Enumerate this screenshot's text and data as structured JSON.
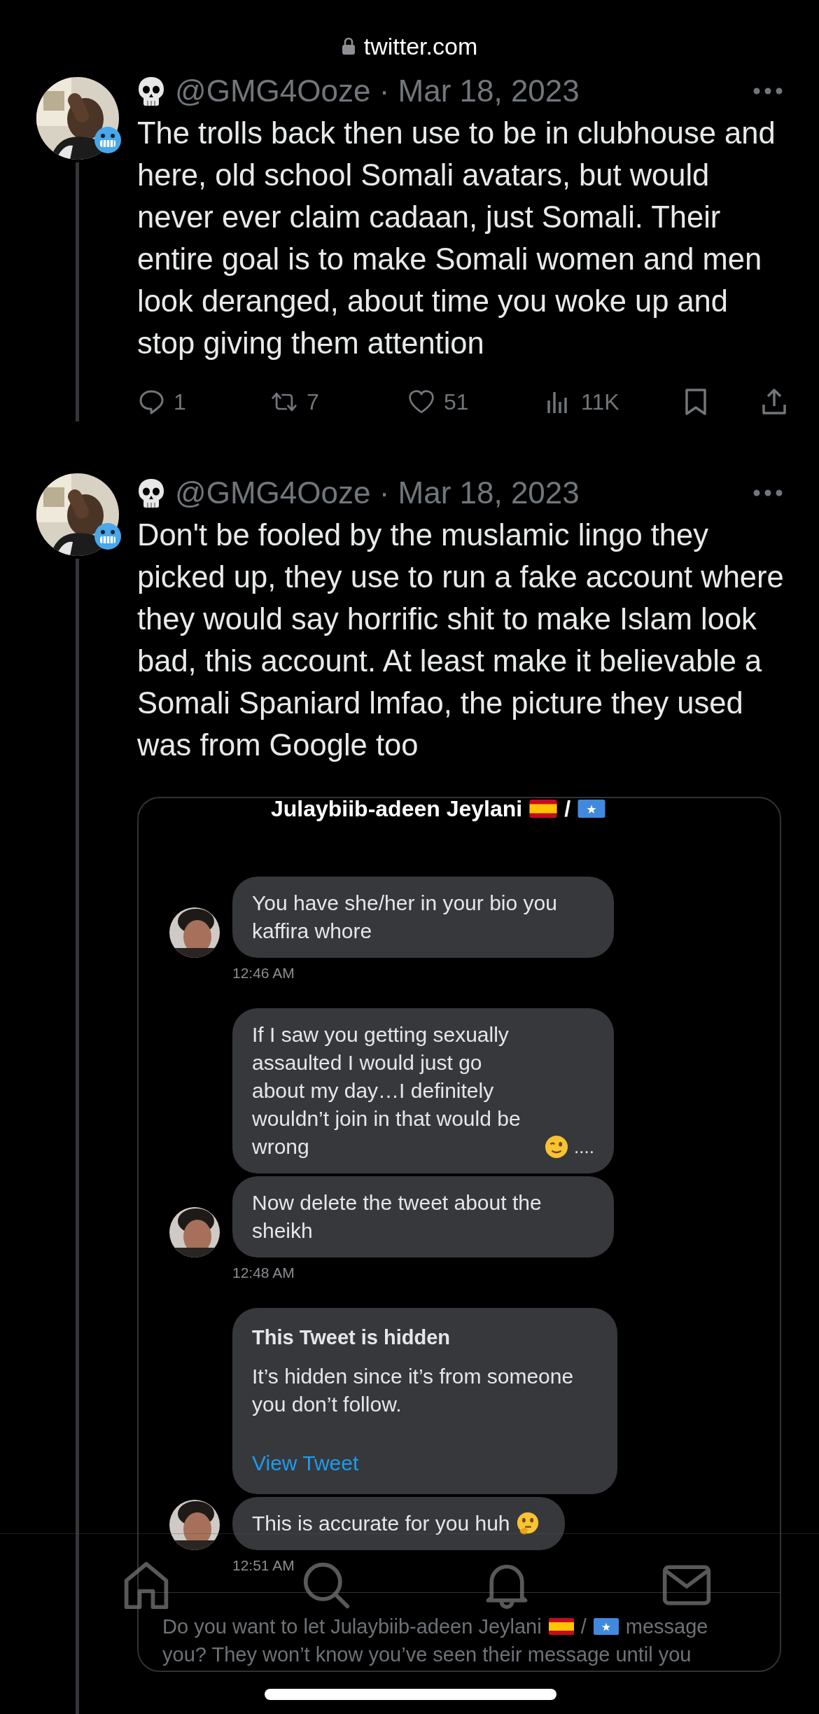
{
  "address_bar": {
    "domain": "twitter.com",
    "secure": true
  },
  "tweets": [
    {
      "avatar": {
        "kind": "picture",
        "badge": true
      },
      "handle": "@GMG4Ooze",
      "separator": "·",
      "date": "Mar 18, 2023",
      "text": "The trolls back then use to be in clubhouse and here, old school Somali avatars, but would never ever claim cadaan, just Somali. Their entire goal is to make Somali women and men look deranged, about time you woke up and stop giving them attention",
      "stats": {
        "replies": "1",
        "retweets": "7",
        "likes": "51",
        "views": "11K"
      }
    },
    {
      "avatar": {
        "kind": "picture",
        "badge": true
      },
      "handle": "@GMG4Ooze",
      "separator": "·",
      "date": "Mar 18, 2023",
      "text": "Don't be fooled by the muslamic lingo they picked up, they use to run a fake account where they would say horrific shit to make Islam look bad, this account. At least make it believable a Somali Spaniard lmfao, the picture they used was from Google too",
      "dm_screenshot": {
        "title": "Julaybiib-adeen Jeylani",
        "title_separator": "/",
        "messages": [
          {
            "kind": "text",
            "text": "You have she/her in your bio you kaffira whore",
            "avatar": true,
            "time": "12:46 AM"
          },
          {
            "kind": "text",
            "text": "If I saw you getting sexually assaulted I would just go about my day…I definitely wouldn’t join in that would be wrong",
            "wink_emoji": true,
            "tail": "....",
            "avatar": false
          },
          {
            "kind": "text",
            "text": "Now delete the tweet about the sheikh",
            "avatar": true,
            "time": "12:48 AM"
          },
          {
            "kind": "hidden_tweet",
            "title": "This Tweet is hidden",
            "body": "It’s hidden since it’s from someone you don’t follow.",
            "link": "View Tweet",
            "avatar": false
          },
          {
            "kind": "text",
            "text": "This is accurate for you huh",
            "thinking_emoji": true,
            "avatar": true,
            "time": "12:51 AM"
          }
        ],
        "prompt_before": "Do you want to let Julaybiib-adeen Jeylani",
        "prompt_separator": "/",
        "prompt_after": "message",
        "prompt_continued": "you? They won’t know you’ve seen their message until you"
      }
    }
  ],
  "bottom_nav": [
    {
      "kind": "home"
    },
    {
      "kind": "search"
    },
    {
      "kind": "notifications"
    },
    {
      "kind": "messages"
    }
  ]
}
